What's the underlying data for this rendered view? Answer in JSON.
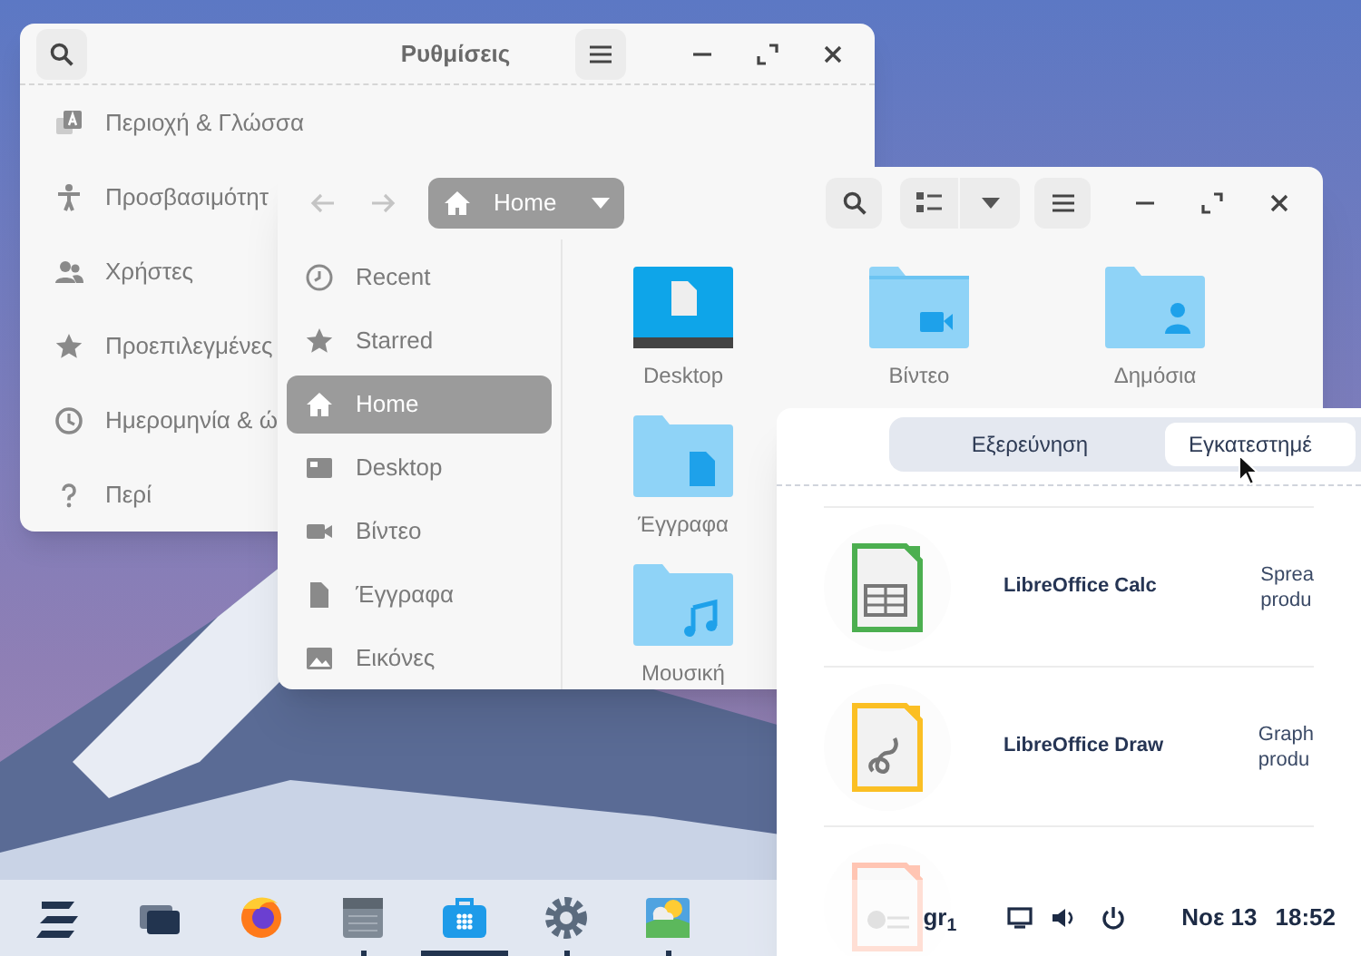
{
  "settings": {
    "title": "Ρυθμίσεις",
    "items": [
      {
        "kind": "region",
        "label": "Περιοχή & Γλώσσα"
      },
      {
        "kind": "accessibility",
        "label": "Προσβασιμότητ"
      },
      {
        "kind": "users",
        "label": "Χρήστες"
      },
      {
        "kind": "star",
        "label": "Προεπιλεγμένες"
      },
      {
        "kind": "clock",
        "label": "Ημερομηνία & ώ"
      },
      {
        "kind": "help",
        "label": "Περί"
      }
    ]
  },
  "files": {
    "path": "Home",
    "sidebar": [
      {
        "kind": "recent",
        "label": "Recent",
        "selected": false
      },
      {
        "kind": "star",
        "label": "Starred",
        "selected": false
      },
      {
        "kind": "home",
        "label": "Home",
        "selected": true
      },
      {
        "kind": "desktop",
        "label": "Desktop",
        "selected": false
      },
      {
        "kind": "video",
        "label": "Βίντεο",
        "selected": false
      },
      {
        "kind": "document",
        "label": "Έγγραφα",
        "selected": false
      },
      {
        "kind": "image",
        "label": "Εικόνες",
        "selected": false
      }
    ],
    "folders": [
      {
        "kind": "desktop",
        "label": "Desktop"
      },
      {
        "kind": "video",
        "label": "Βίντεο"
      },
      {
        "kind": "public",
        "label": "Δημόσια"
      },
      {
        "kind": "documents",
        "label": "Έγγραφα"
      },
      {
        "kind": "music",
        "label": "Μουσική"
      }
    ]
  },
  "software": {
    "tabs": [
      {
        "label": "Εξερεύνηση",
        "selected": false
      },
      {
        "label": "Εγκατεστημέ",
        "selected": true
      }
    ],
    "apps": [
      {
        "kind": "calc",
        "name": "LibreOffice Calc",
        "description": [
          "Sprea",
          "produ"
        ]
      },
      {
        "kind": "draw",
        "name": "LibreOffice Draw",
        "description": [
          "Graph",
          "produ"
        ]
      },
      {
        "kind": "impress"
      }
    ]
  },
  "taskbar": {
    "apps": [
      {
        "kind": "zorin",
        "running": false,
        "selected": false
      },
      {
        "kind": "windows",
        "running": false,
        "selected": false
      },
      {
        "kind": "firefox",
        "running": false,
        "selected": false
      },
      {
        "kind": "files",
        "running": true,
        "selected": false
      },
      {
        "kind": "store",
        "running": true,
        "selected": true
      },
      {
        "kind": "settings",
        "running": true,
        "selected": false
      },
      {
        "kind": "weather",
        "running": true,
        "selected": false
      }
    ],
    "keyboard": "gr$_{1}$",
    "date": "Νοε 13",
    "time": "18:52"
  }
}
